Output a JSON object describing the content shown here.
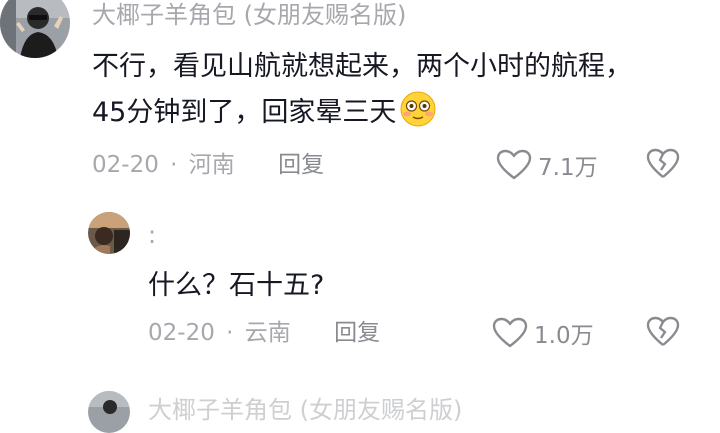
{
  "comments": [
    {
      "username": "大椰子羊角包 (女朋友赐名版)",
      "text_line1": "不行，看见山航就想起来，两个小时的航程，",
      "text_line2": "45分钟到了，回家晕三天",
      "date": "02-20",
      "separator": "·",
      "location": "河南",
      "reply_label": "回复",
      "likes": "7.1万",
      "emoji_icon": "flushed-face-emoji"
    },
    {
      "username": ":",
      "text": "什么？石十五?",
      "date": "02-20",
      "separator": "·",
      "location": "云南",
      "reply_label": "回复",
      "likes": "1.0万"
    },
    {
      "username": "大椰子羊角包 (女朋友赐名版)"
    }
  ],
  "colors": {
    "text_primary": "#161823",
    "text_secondary": "#a7a8ad",
    "icon": "#8a8b91",
    "background": "#ffffff"
  }
}
